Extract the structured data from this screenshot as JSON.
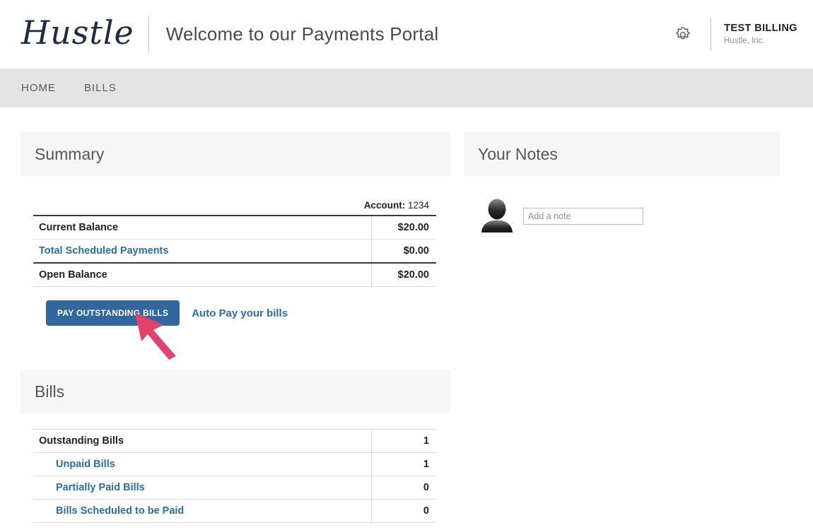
{
  "header": {
    "brand": "Hustle",
    "welcome": "Welcome to our Payments Portal",
    "gear_icon": "gear-icon",
    "account_name": "TEST BILLING",
    "account_org": "Hustle, Inc."
  },
  "nav": {
    "items": [
      {
        "label": "HOME"
      },
      {
        "label": "BILLS"
      }
    ]
  },
  "summary": {
    "title": "Summary",
    "account_label": "Account:",
    "account_number": "1234",
    "rows": [
      {
        "label": "Current Balance",
        "value": "$20.00",
        "is_link": false
      },
      {
        "label": "Total Scheduled Payments",
        "value": "$0.00",
        "is_link": true
      },
      {
        "label": "Open Balance",
        "value": "$20.00",
        "is_link": false
      }
    ],
    "pay_button": "PAY OUTSTANDING BILLS",
    "autopay_link": "Auto Pay your bills"
  },
  "bills": {
    "title": "Bills",
    "rows": [
      {
        "label": "Outstanding Bills",
        "value": "1",
        "is_link": false,
        "indent": false
      },
      {
        "label": "Unpaid Bills",
        "value": "1",
        "is_link": true,
        "indent": true
      },
      {
        "label": "Partially Paid Bills",
        "value": "0",
        "is_link": true,
        "indent": true
      },
      {
        "label": "Bills Scheduled to be Paid",
        "value": "0",
        "is_link": true,
        "indent": true
      }
    ]
  },
  "notes": {
    "title": "Your Notes",
    "avatar_icon": "user-avatar-icon",
    "note_placeholder": "Add a note",
    "note_value": ""
  },
  "annotation": {
    "arrow_icon": "pointer-arrow-icon",
    "arrow_color": "#e0436b"
  },
  "colors": {
    "link_blue": "#2e6ca4",
    "button_blue": "#31679d",
    "nav_background": "#e4e4e4",
    "panel_header": "#f6f6f6",
    "brand_navy": "#1f2a44"
  }
}
